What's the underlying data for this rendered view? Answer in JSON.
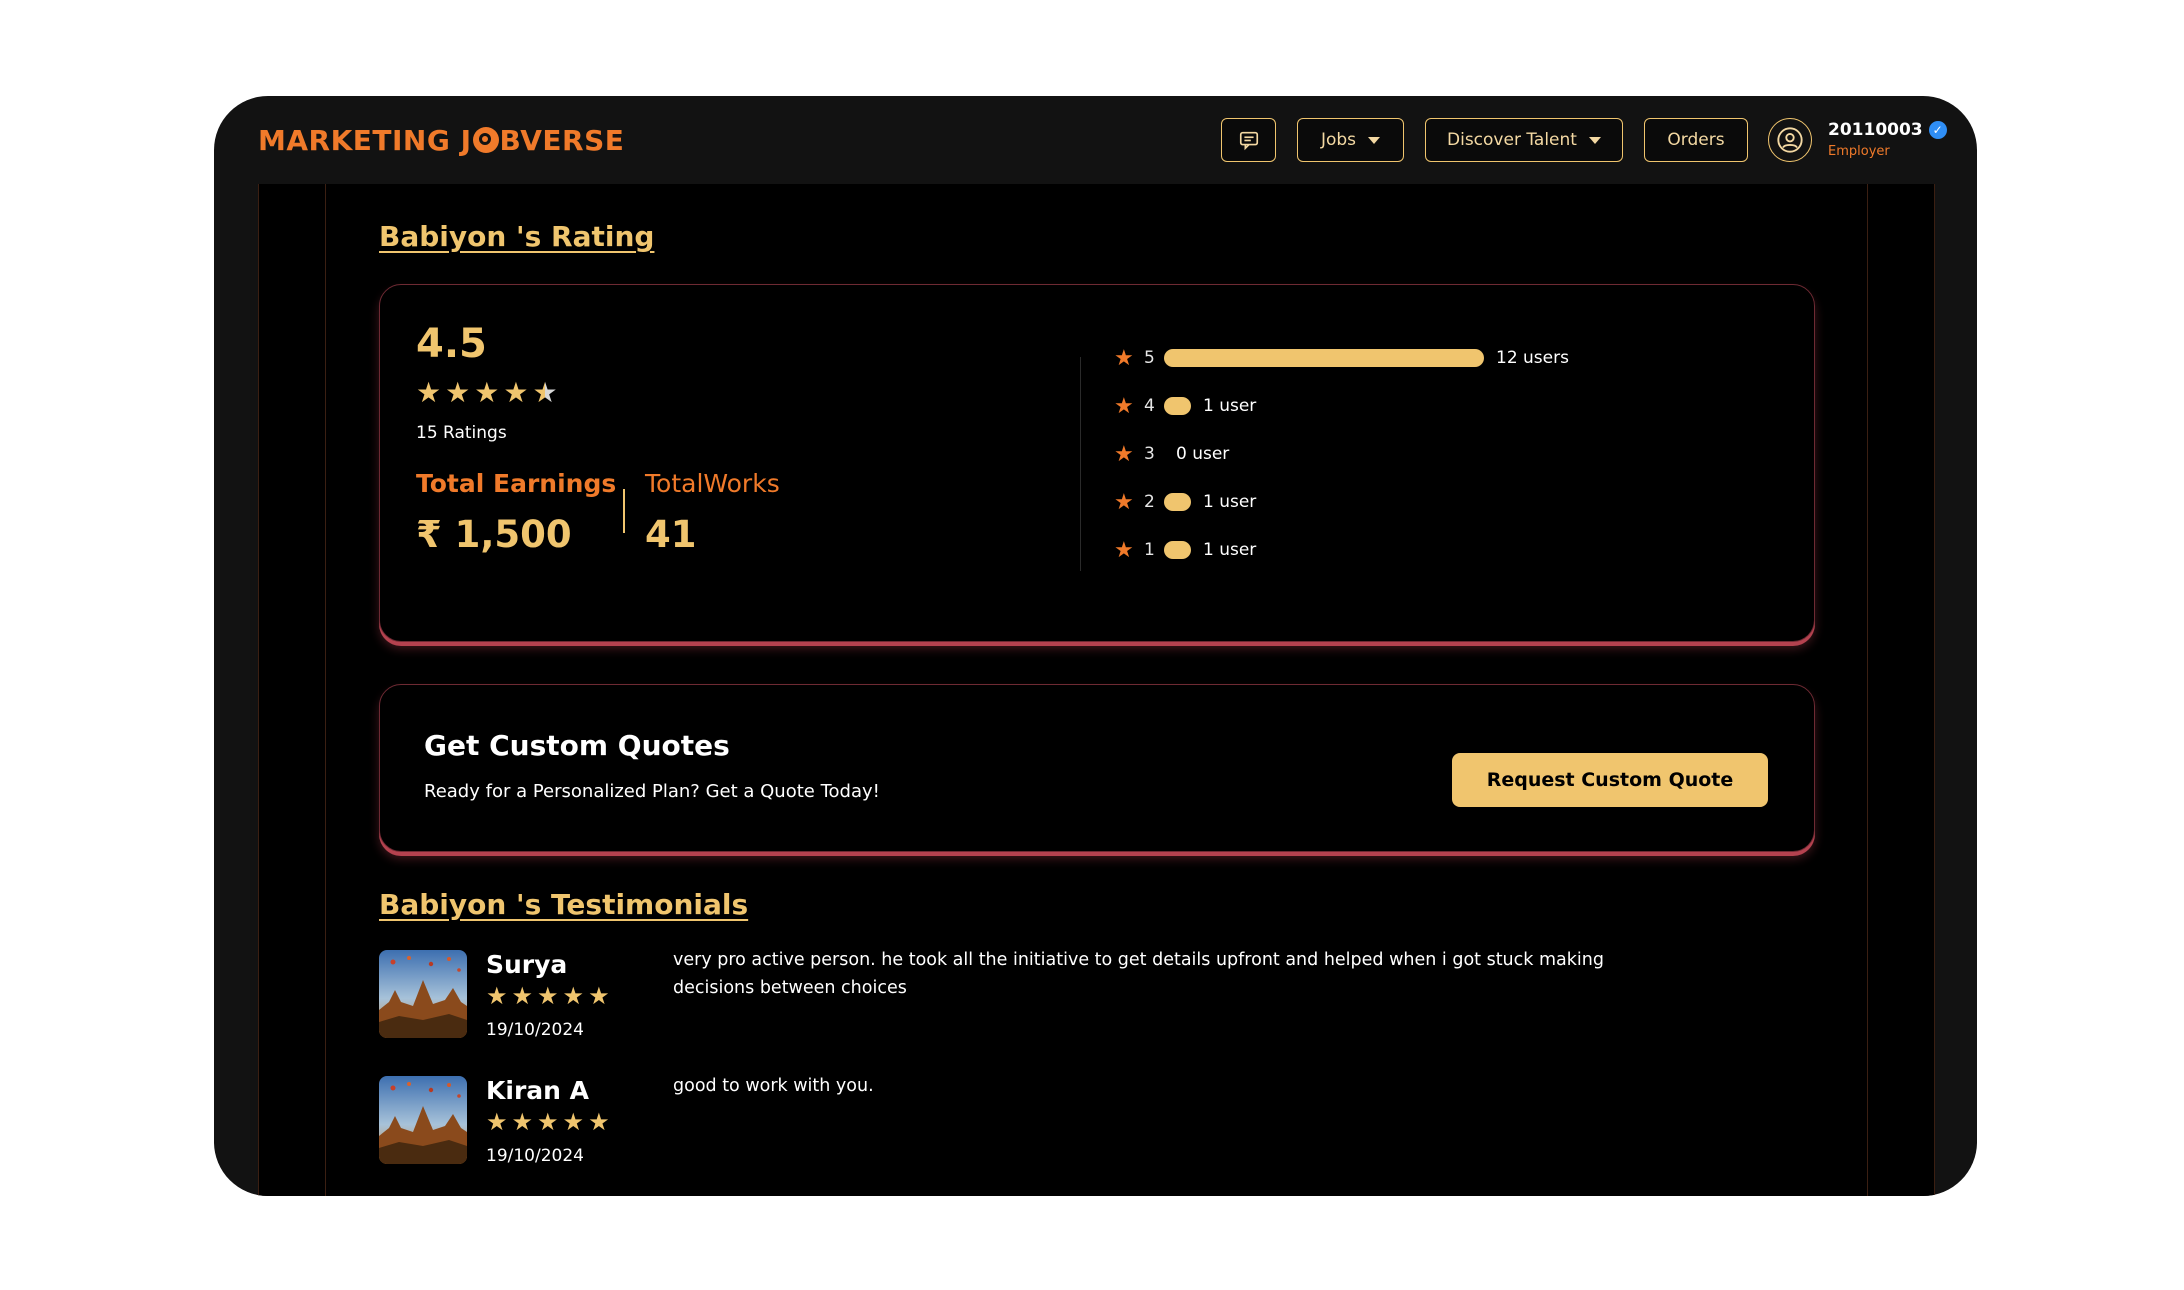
{
  "header": {
    "logo": {
      "before": "MARKETING J",
      "after": "BVERSE"
    },
    "nav": {
      "jobs": "Jobs",
      "discover_talent": "Discover Talent",
      "orders": "Orders"
    },
    "user": {
      "id": "20110003",
      "role": "Employer"
    }
  },
  "rating": {
    "title": "Babiyon 's Rating",
    "average": "4.5",
    "stars_filled": 4.5,
    "count_text": "15 Ratings",
    "earnings_label": "Total Earnings",
    "earnings_value": "₹ 1,500",
    "works_label": "TotalWorks",
    "works_value": "41",
    "breakdown": [
      {
        "stars": "5",
        "label": "12 users",
        "fraction": 1.0
      },
      {
        "stars": "4",
        "label": "1 user",
        "fraction": 0.083
      },
      {
        "stars": "3",
        "label": "0 user",
        "fraction": 0
      },
      {
        "stars": "2",
        "label": "1 user",
        "fraction": 0.083
      },
      {
        "stars": "1",
        "label": "1 user",
        "fraction": 0.083
      }
    ]
  },
  "quote": {
    "title": "Get Custom Quotes",
    "subtitle": "Ready for a Personalized Plan? Get a Quote Today!",
    "button": "Request Custom Quote"
  },
  "testimonials": {
    "title": "Babiyon 's Testimonials",
    "items": [
      {
        "name": "Surya",
        "stars": 5,
        "date": "19/10/2024",
        "text": "very pro active person. he took all the initiative to get details upfront and helped when i got stuck making decisions between choices"
      },
      {
        "name": "Kiran A",
        "stars": 5,
        "date": "19/10/2024",
        "text": "good to work with you."
      }
    ]
  },
  "colors": {
    "accent_orange": "#f07a2a",
    "accent_gold": "#f0c56e",
    "card_glow": "#b4424f"
  }
}
